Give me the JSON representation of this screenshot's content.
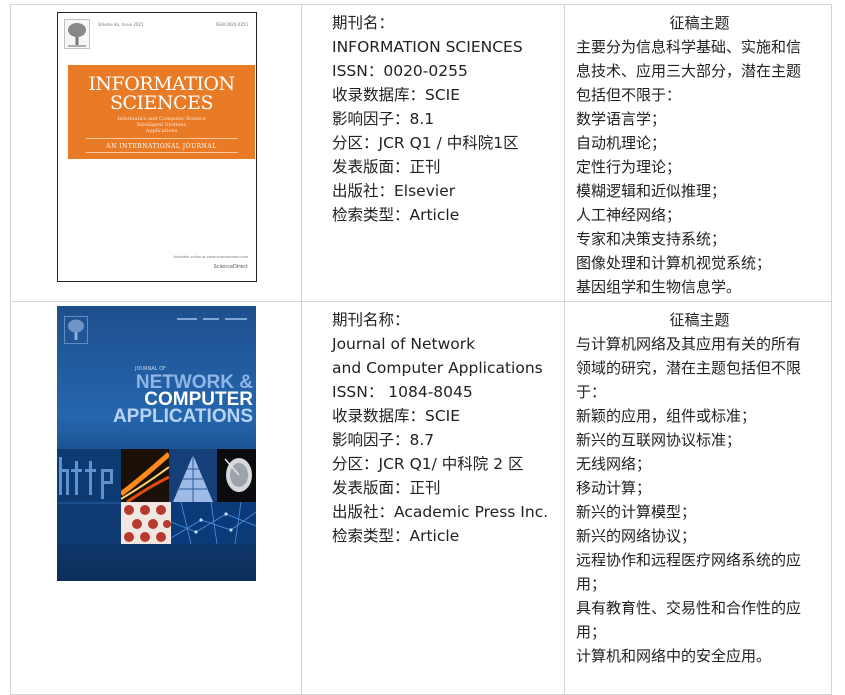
{
  "rows": [
    {
      "cover": {
        "title_line1": "INFORMATION",
        "title_line2": "SCIENCES",
        "subtitle_lines": [
          "Informatics and Computer Science",
          "Intelligent Systems",
          "Applications"
        ],
        "tagline": "AN INTERNATIONAL JOURNAL",
        "issue_text": "Volume 8x, Issue 2021",
        "issn_text": "ISSN 0020-0255",
        "available_text": "Available online at www.sciencedirect.com",
        "footer_brand": "ScienceDirect",
        "accent_color": "#ea7b26"
      },
      "info_lines": [
        "期刊名：",
        "INFORMATION SCIENCES",
        "ISSN：0020-0255",
        "收录数据库：SCIE",
        "影响因子：8.1",
        "分区：JCR Q1 / 中科院1区",
        "发表版面：正刊",
        "出版社：Elsevier",
        "检索类型：Article"
      ],
      "topics": {
        "header": "征稿主题",
        "lines": [
          "主要分为信息科学基础、实施和信",
          "息技术、应用三大部分，潜在主题",
          "包括但不限于：",
          "数学语言学；",
          "自动机理论；",
          "定性行为理论；",
          "模糊逻辑和近似推理；",
          "人工神经网络；",
          "专家和决策支持系统；",
          "图像处理和计算机视觉系统；",
          "基因组学和生物信息学。"
        ]
      }
    },
    {
      "cover": {
        "journal_of": "JOURNAL OF",
        "title_line1": "NETWORK &",
        "title_line2": "COMPUTER",
        "title_line3": "APPLICATIONS",
        "accent_color": "#1e5aa0"
      },
      "info_lines": [
        "期刊名称：",
        "Journal of Network",
        "and Computer Applications",
        "ISSN： 1084-8045",
        "收录数据库：SCIE",
        "影响因子：8.7",
        "分区：JCR Q1/ 中科院 2 区",
        "发表版面：正刊",
        "出版社：Academic Press Inc.",
        "检索类型：Article"
      ],
      "topics": {
        "header": "征稿主题",
        "lines": [
          "与计算机网络及其应用有关的所有",
          "领域的研究，潜在主题包括但不限",
          "于：",
          "新颖的应用，组件或标准；",
          "新兴的互联网协议标准；",
          "无线网络；",
          "移动计算；",
          "新兴的计算模型；",
          "新兴的网络协议；",
          "远程协作和远程医疗网络系统的应",
          "用；",
          "具有教育性、交易性和合作性的应",
          "用；",
          "计算机和网络中的安全应用。"
        ]
      }
    }
  ]
}
